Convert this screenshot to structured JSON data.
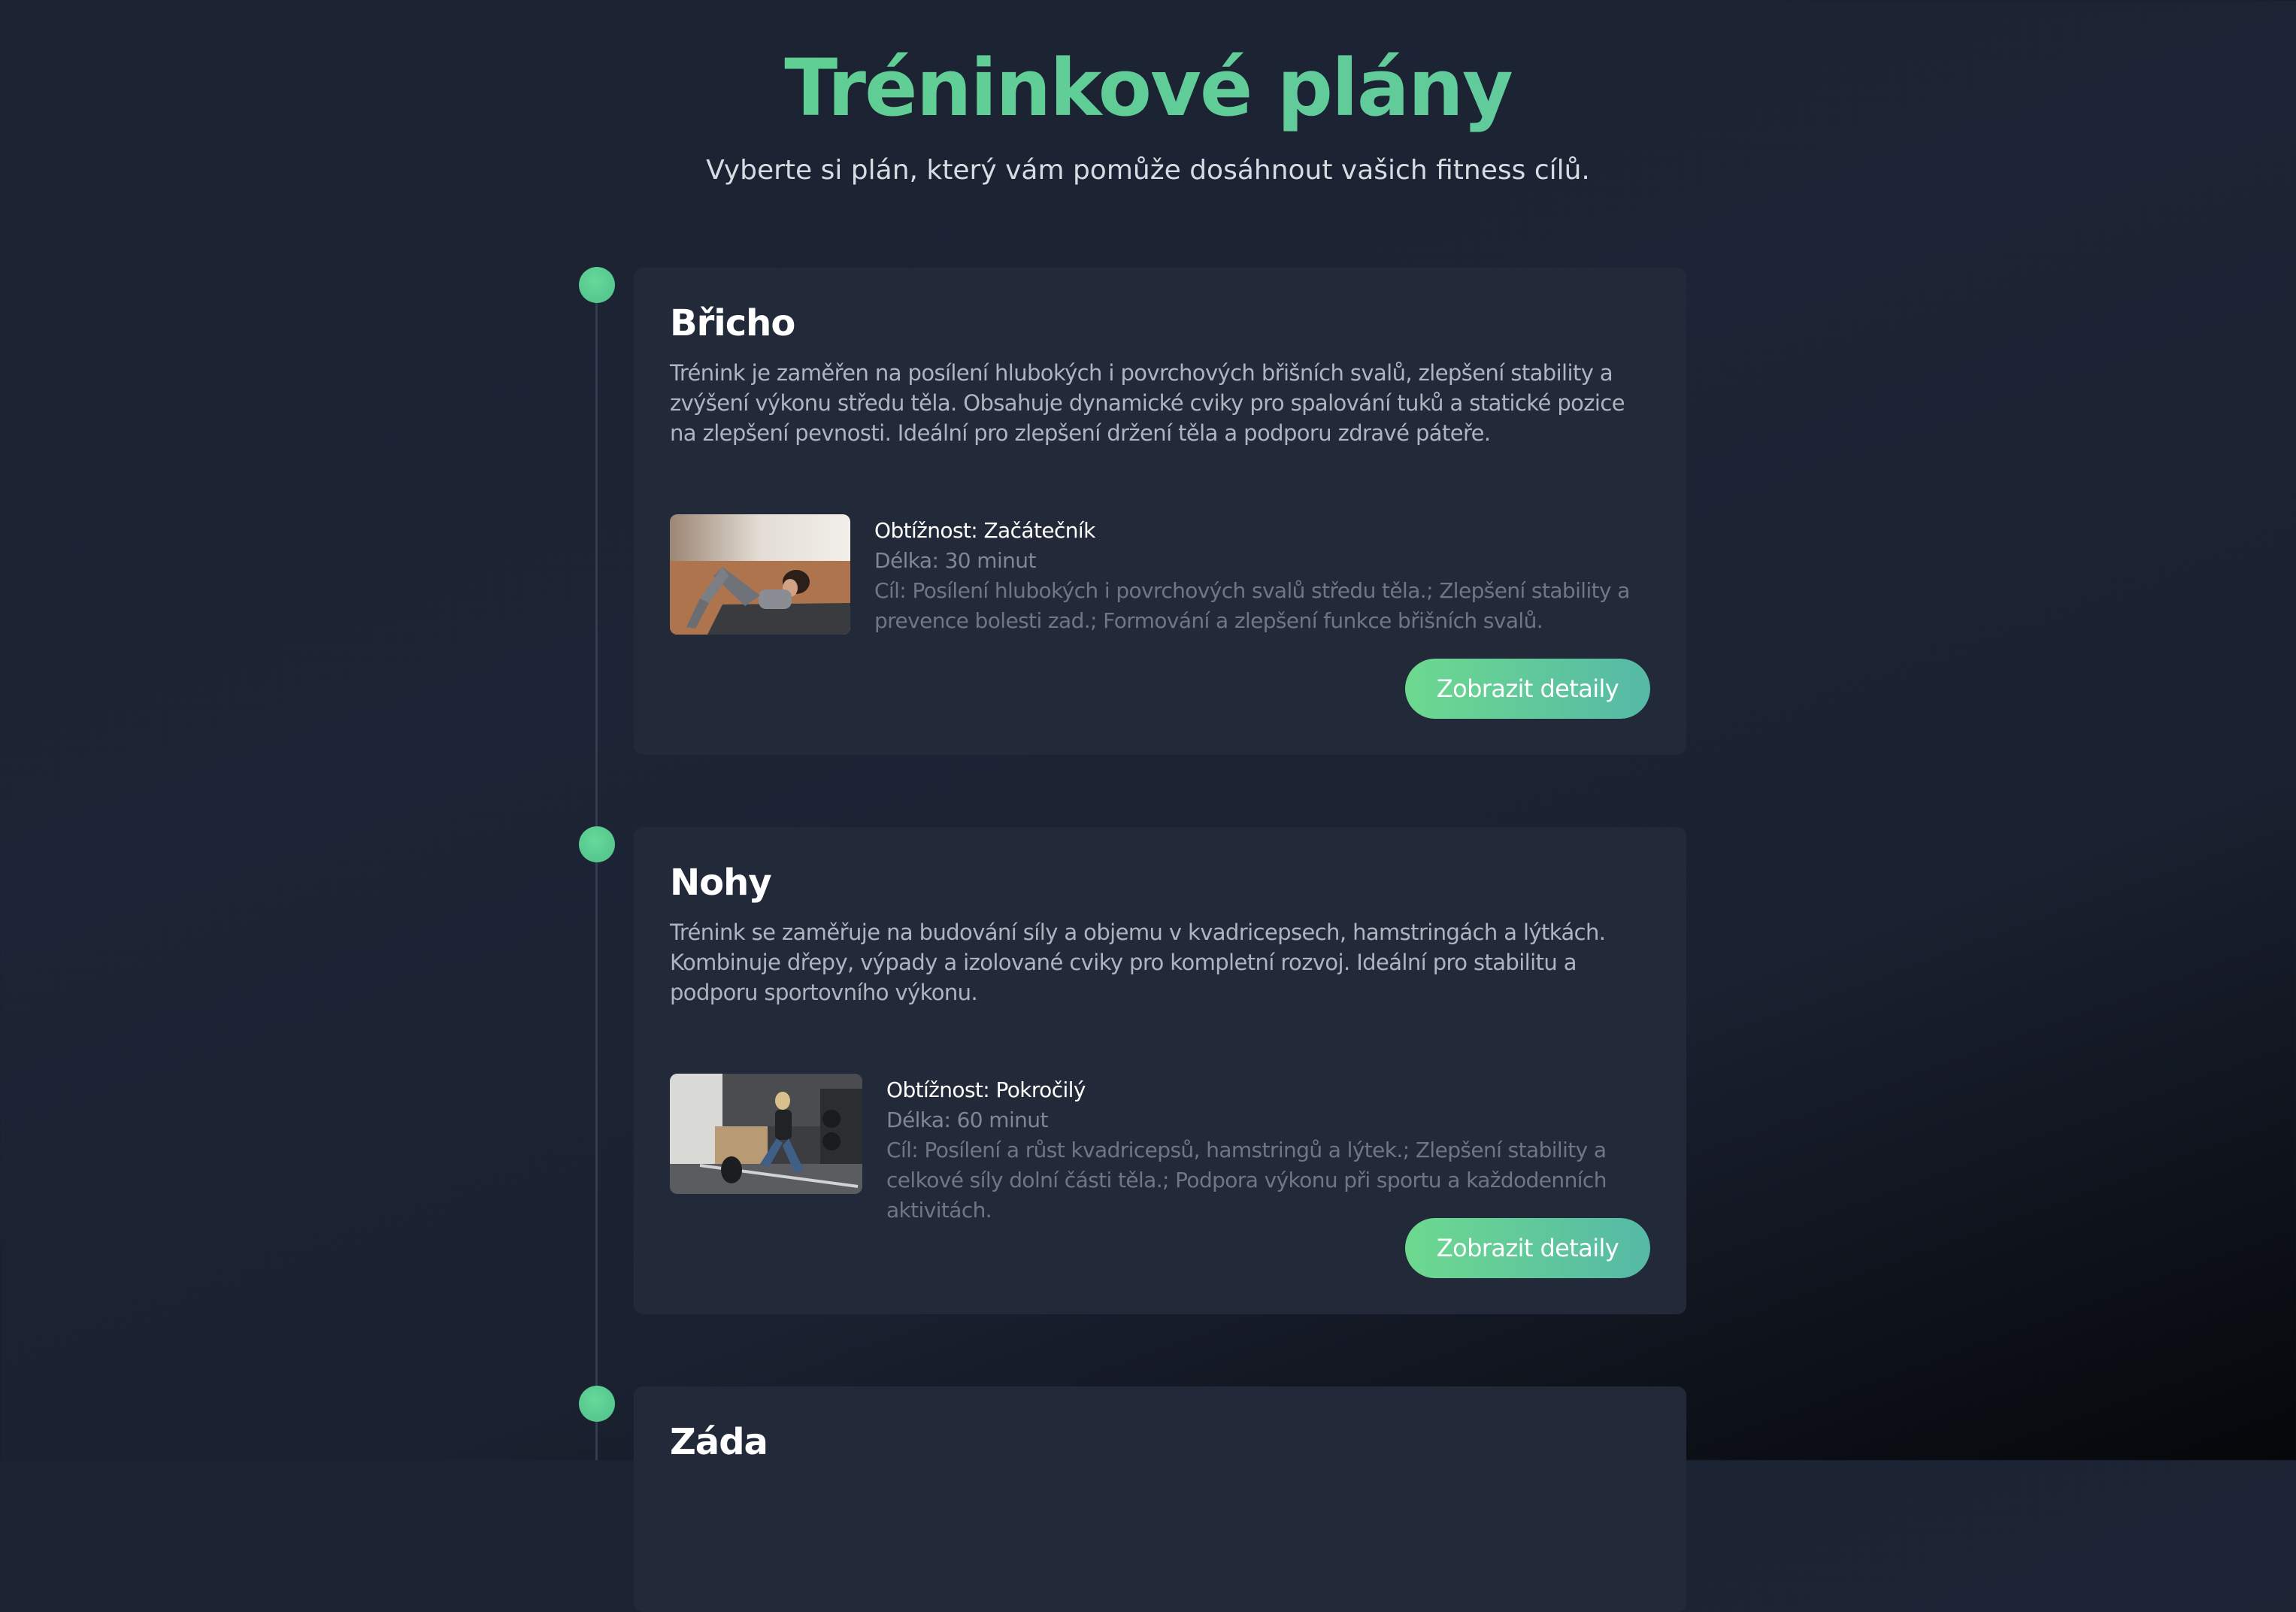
{
  "header": {
    "title": "Tréninkové plány",
    "subtitle": "Vyberte si plán, který vám pomůže dosáhnout vašich fitness cílů."
  },
  "plans": [
    {
      "title": "Břicho",
      "description": "Trénink je zaměřen na posílení hlubokých i povrchových břišních svalů, zlepšení stability a zvýšení výkonu středu těla. Obsahuje dynamické cviky pro spalování tuků a statické pozice na zlepšení pevnosti. Ideální pro zlepšení držení těla a podporu zdravé páteře.",
      "difficulty": "Obtížnost: Začátečník",
      "duration": "Délka: 30 minut",
      "goal": "Cíl: Posílení hlubokých i povrchových svalů středu těla.; Zlepšení stability a prevence bolesti zad.; Formování a zlepšení funkce břišních svalů.",
      "button_label": "Zobrazit detaily"
    },
    {
      "title": "Nohy",
      "description": "Trénink se zaměřuje na budování síly a objemu v kvadricepsech, hamstringách a lýtkách. Kombinuje dřepy, výpady a izolované cviky pro kompletní rozvoj. Ideální pro stabilitu a podporu sportovního výkonu.",
      "difficulty": "Obtížnost: Pokročilý",
      "duration": "Délka: 60 minut",
      "goal": "Cíl: Posílení a růst kvadricepsů, hamstringů a lýtek.; Zlepšení stability a celkové síly dolní části těla.; Podpora výkonu při sportu a každodenních aktivitách.",
      "button_label": "Zobrazit detaily"
    },
    {
      "title": "Záda"
    }
  ]
}
